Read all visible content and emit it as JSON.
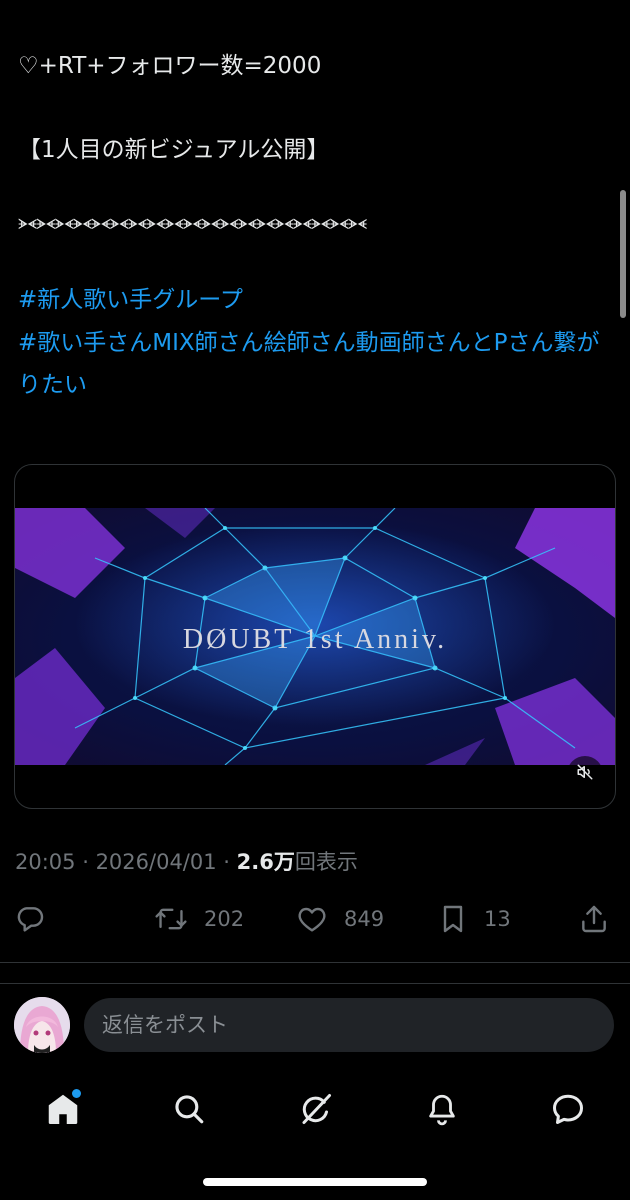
{
  "tweet": {
    "line1": "♡+RT+フォロワー数=2000",
    "line2": "【1人目の新ビジュアル公開】",
    "divider": "ᗘᗛᗘᗛᗘᗛᗘᗛᗘᗛᗘᗛᗘᗛᗘᗛᗘᗛᗘᗛᗘᗛᗘᗛᗘᗛᗘᗛᗘᗛᗘᗛᗘᗛᗘᗛᗘᗛ",
    "hashtag1": "#新人歌い手グループ",
    "hashtag2": "#歌い手さんMIX師さん絵師さん動画師さんとPさん繋がりたい"
  },
  "media": {
    "video_title": "DØUBT 1st Anniv."
  },
  "meta": {
    "time": "20:05",
    "dot1": " · ",
    "date": "2026/04/01",
    "dot2": " · ",
    "views_number": "2.6",
    "views_unit": "万",
    "views_label": "回表示"
  },
  "actions": {
    "retweets": "202",
    "likes": "849",
    "bookmarks": "13"
  },
  "reply": {
    "placeholder": "返信をポスト"
  },
  "nav": {
    "items": [
      "home",
      "search",
      "grok",
      "notifications",
      "messages"
    ]
  },
  "colors": {
    "background": "#000000",
    "text": "#e7e9ea",
    "hashtag": "#1d9bf0",
    "muted": "#71767b",
    "separator": "#2f3336",
    "input_bg": "#202327",
    "badge": "#1d9bf0"
  },
  "icons": {
    "reply": "reply-icon",
    "retweet": "retweet-icon",
    "like": "heart-icon",
    "bookmark": "bookmark-icon",
    "share": "share-icon",
    "mute": "muted-speaker-icon",
    "home": "home-icon",
    "search": "search-icon",
    "grok": "grok-icon",
    "notifications": "bell-icon",
    "messages": "messages-icon"
  }
}
